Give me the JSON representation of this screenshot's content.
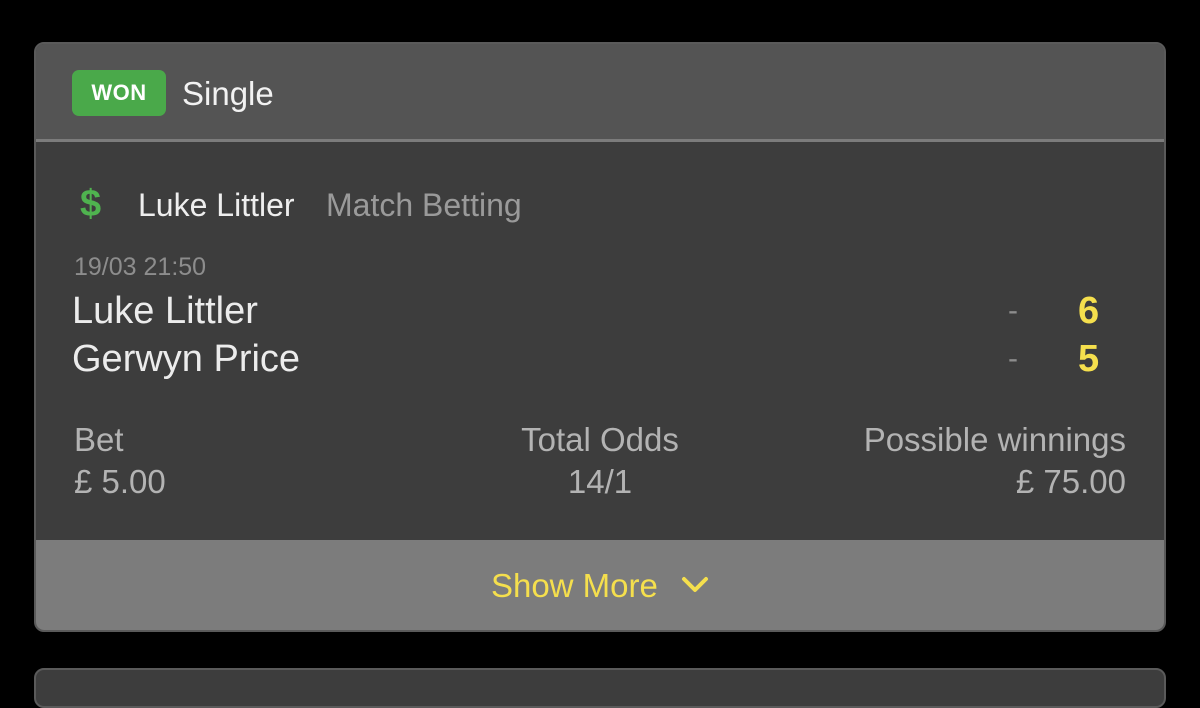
{
  "bet": {
    "status": "WON",
    "type": "Single",
    "selection": "Luke Littler",
    "market": "Match Betting",
    "event_time": "19/03 21:50",
    "teams": [
      {
        "name": "Luke Littler",
        "dash": "-",
        "score": "6"
      },
      {
        "name": "Gerwyn Price",
        "dash": "-",
        "score": "5"
      }
    ],
    "stake": {
      "label": "Bet",
      "value": "£ 5.00"
    },
    "odds": {
      "label": "Total Odds",
      "value": "14/1"
    },
    "winnings": {
      "label": "Possible winnings",
      "value": "£ 75.00"
    },
    "show_more_label": "Show More"
  },
  "icons": {
    "market_icon": "dollar-icon",
    "expand_icon": "chevron-down-icon"
  },
  "colors": {
    "won_badge": "#4aa94a",
    "accent_yellow": "#f5df4d",
    "card_bg": "#3d3d3d",
    "header_bg": "#545454",
    "footer_bg": "#7c7c7c"
  }
}
